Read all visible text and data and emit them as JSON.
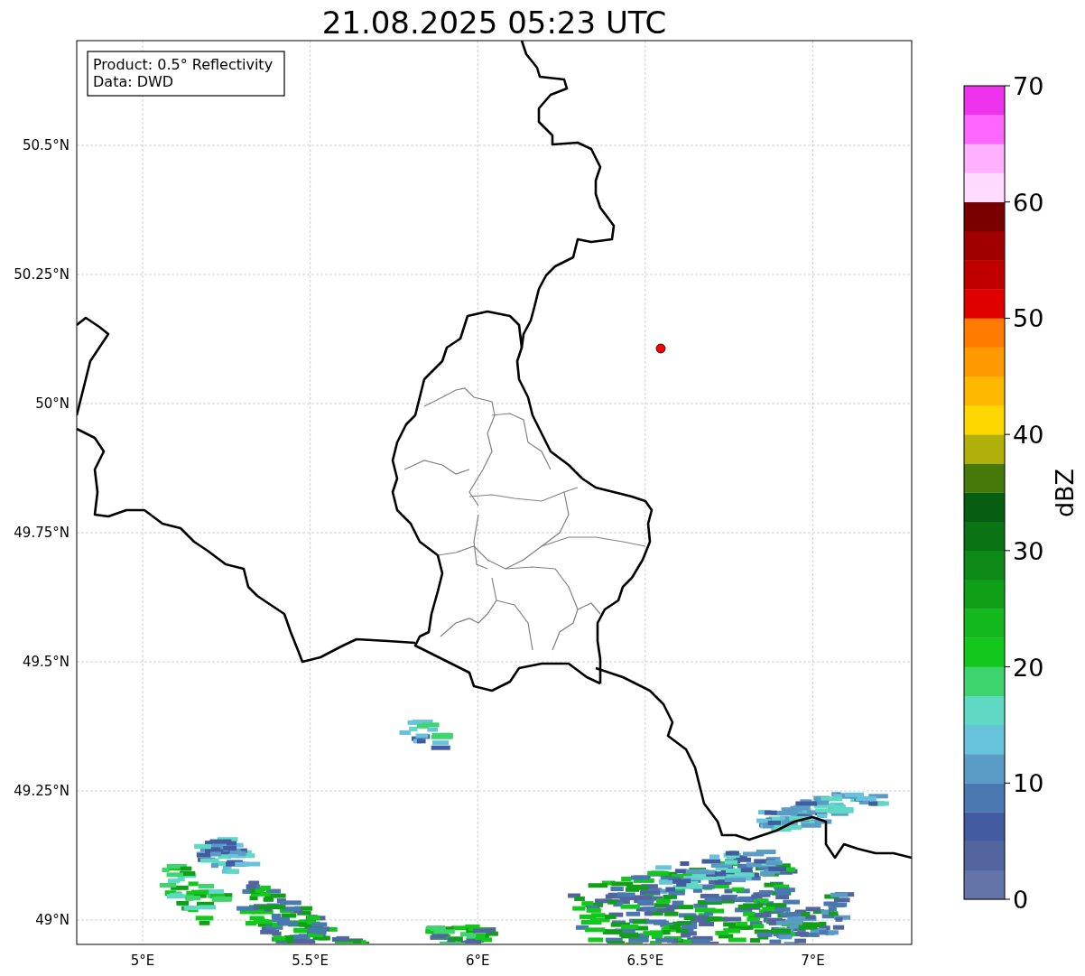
{
  "title": "21.08.2025 05:23 UTC",
  "info_box": [
    "Product: 0.5° Reflectivity",
    "Data: DWD"
  ],
  "y_ticks": [
    "50.5°N",
    "50.25°N",
    "50°N",
    "49.75°N",
    "49.5°N",
    "49.25°N",
    "49°N"
  ],
  "x_ticks": [
    "5°E",
    "5.5°E",
    "6°E",
    "6.5°E",
    "7°E"
  ],
  "colorbar": {
    "label": "dBZ",
    "ticks": [
      "70",
      "60",
      "50",
      "40",
      "30",
      "20",
      "10",
      "0"
    ],
    "segments": [
      {
        "color": "#6474a8"
      },
      {
        "color": "#52659e"
      },
      {
        "color": "#435ba0"
      },
      {
        "color": "#4a78b0"
      },
      {
        "color": "#5b9cc6"
      },
      {
        "color": "#67c2dc"
      },
      {
        "color": "#5fd8c4"
      },
      {
        "color": "#3fd56e"
      },
      {
        "color": "#12c81c"
      },
      {
        "color": "#12b81c"
      },
      {
        "color": "#10a018"
      },
      {
        "color": "#0e8a18"
      },
      {
        "color": "#0a7414"
      },
      {
        "color": "#075e10"
      },
      {
        "color": "#457a0b"
      },
      {
        "color": "#b0b00a"
      },
      {
        "color": "#ffd700"
      },
      {
        "color": "#ffb800"
      },
      {
        "color": "#ff9900"
      },
      {
        "color": "#ff7c00"
      },
      {
        "color": "#e10000"
      },
      {
        "color": "#c00000"
      },
      {
        "color": "#a00000"
      },
      {
        "color": "#780000"
      },
      {
        "color": "#ffdcff"
      },
      {
        "color": "#ffb0ff"
      },
      {
        "color": "#ff66ff"
      },
      {
        "color": "#ee33ee"
      }
    ]
  }
}
